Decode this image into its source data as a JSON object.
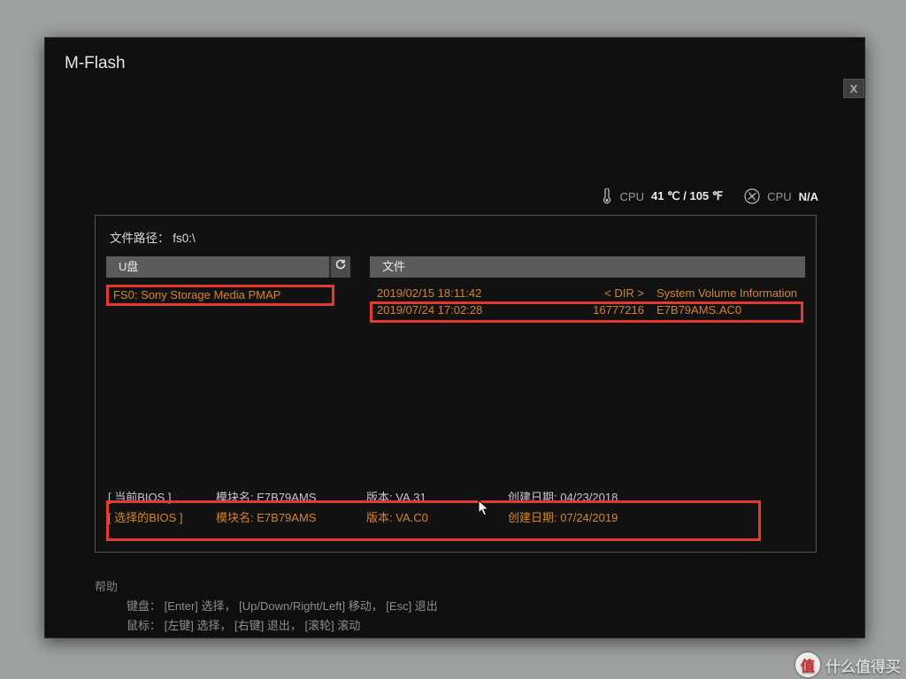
{
  "window": {
    "title": "M-Flash",
    "close_label": "X"
  },
  "sensors": {
    "cpu_temp_label": "CPU",
    "cpu_temp_value": "41 ℃ / 105 ℉",
    "cpu_fan_label": "CPU",
    "cpu_fan_value": "N/A"
  },
  "path": {
    "label": "文件路径：",
    "value": "fs0:\\"
  },
  "columns": {
    "drives_header": "U盘",
    "files_header": "文件"
  },
  "drives": [
    {
      "label": "FS0: Sony Storage Media PMAP"
    }
  ],
  "files": [
    {
      "date": "2019/02/15 18:11:42",
      "size": "< DIR >",
      "name": "System Volume Information"
    },
    {
      "date": "2019/07/24 17:02:28",
      "size": "16777216",
      "name": "E7B79AMS.AC0"
    }
  ],
  "bios": {
    "current": {
      "tag": "[    当前BIOS    ]",
      "module_label": "模块名:",
      "module": "E7B79AMS",
      "version_label": "版本:",
      "version": "VA.31",
      "date_label": "创建日期:",
      "date": "04/23/2018"
    },
    "selected": {
      "tag": "[  选择的BIOS   ]",
      "module_label": "模块名:",
      "module": "E7B79AMS",
      "version_label": "版本:",
      "version": "VA.C0",
      "date_label": "创建日期:",
      "date": "07/24/2019"
    }
  },
  "help": {
    "title": "帮助",
    "line1": "键盘：  [Enter] 选择，  [Up/Down/Right/Left] 移动，  [Esc] 退出",
    "line2": "鼠标：  [左键] 选择，  [右键] 退出，  [滚轮] 滚动"
  },
  "watermark": {
    "badge": "值",
    "text": "什么值得买"
  }
}
